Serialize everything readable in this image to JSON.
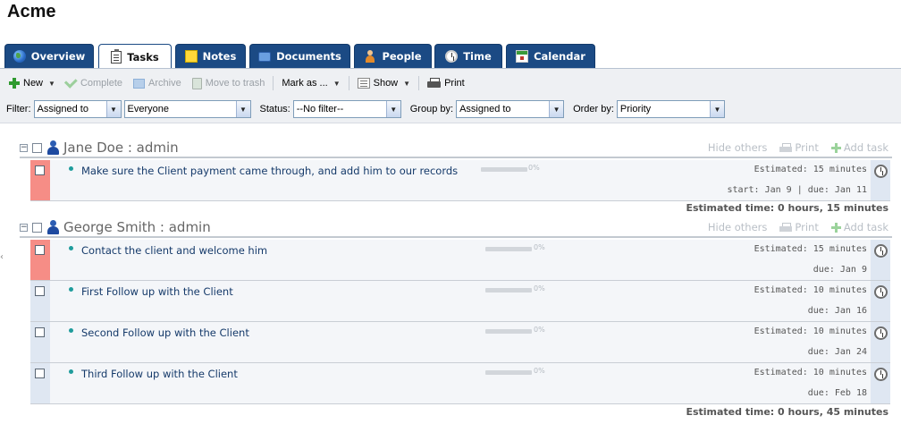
{
  "company": "Acme",
  "tabs": [
    {
      "label": "Overview",
      "icon": "globe-icon",
      "active": false
    },
    {
      "label": "Tasks",
      "icon": "tasks-icon",
      "active": true
    },
    {
      "label": "Notes",
      "icon": "notes-icon",
      "active": false
    },
    {
      "label": "Documents",
      "icon": "documents-icon",
      "active": false
    },
    {
      "label": "People",
      "icon": "people-icon",
      "active": false
    },
    {
      "label": "Time",
      "icon": "clock-icon",
      "active": false
    },
    {
      "label": "Calendar",
      "icon": "calendar-icon",
      "active": false
    }
  ],
  "toolbar": {
    "new": "New",
    "complete": "Complete",
    "archive": "Archive",
    "move_to_trash": "Move to trash",
    "mark_as": "Mark as ...",
    "show": "Show",
    "print": "Print"
  },
  "filters": {
    "filter_label": "Filter:",
    "filter_value": "Assigned to",
    "filter_target": "Everyone",
    "status_label": "Status:",
    "status_value": "--No filter--",
    "group_label": "Group by:",
    "group_value": "Assigned to",
    "order_label": "Order by:",
    "order_value": "Priority"
  },
  "group_actions": {
    "hide_others": "Hide others",
    "print": "Print",
    "add_task": "Add task"
  },
  "groups": [
    {
      "title": "Jane Doe : admin",
      "tasks": [
        {
          "name": "Make sure the Client payment came through, and add him to our records",
          "progress": 0,
          "progress_label": "0%",
          "estimated": "Estimated: 15 minutes",
          "dates": "start: Jan 9 | due: Jan 11",
          "priority": "high"
        }
      ],
      "total": "Estimated time: 0 hours, 15 minutes"
    },
    {
      "title": "George Smith : admin",
      "tasks": [
        {
          "name": "Contact the client and welcome him",
          "progress": 0,
          "progress_label": "0%",
          "estimated": "Estimated: 15 minutes",
          "dates": "due: Jan 9",
          "priority": "high"
        },
        {
          "name": "First Follow up with the Client",
          "progress": 0,
          "progress_label": "0%",
          "estimated": "Estimated: 10 minutes",
          "dates": "due: Jan 16",
          "priority": "normal"
        },
        {
          "name": "Second Follow up with the Client",
          "progress": 0,
          "progress_label": "0%",
          "estimated": "Estimated: 10 minutes",
          "dates": "due: Jan 24",
          "priority": "normal"
        },
        {
          "name": "Third Follow up with the Client",
          "progress": 0,
          "progress_label": "0%",
          "estimated": "Estimated: 10 minutes",
          "dates": "due: Feb 18",
          "priority": "normal"
        }
      ],
      "total": "Estimated time: 0 hours, 45 minutes"
    }
  ]
}
